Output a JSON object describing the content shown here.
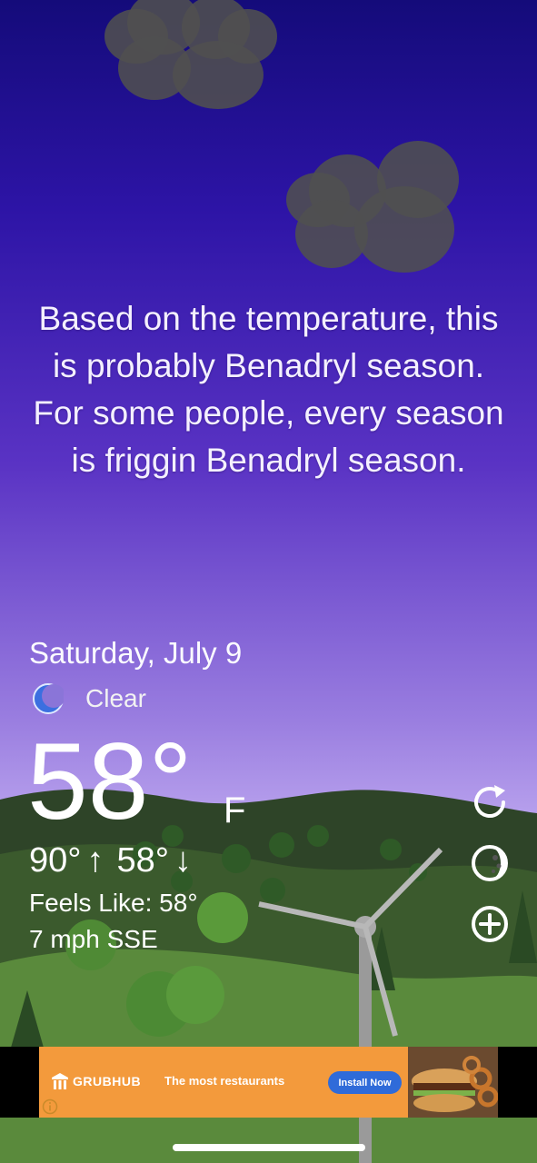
{
  "message": "Based on the temperature, this is probably Benadryl season. For some people, every season is friggin Benadryl season.",
  "weather": {
    "date": "Saturday, July 9",
    "condition": "Clear",
    "condition_icon": "moon-icon",
    "temperature": "58°",
    "unit": "F",
    "high": "90°",
    "high_arrow": "↑",
    "low": "58°",
    "low_arrow": "↓",
    "feels_like": "Feels Like: 58°",
    "wind": "7 mph SSE"
  },
  "side_controls": [
    {
      "name": "refresh-icon"
    },
    {
      "name": "theme-icon"
    },
    {
      "name": "add-location-icon"
    }
  ],
  "ad": {
    "brand": "GRUBHUB",
    "tagline": "The most restaurants",
    "cta": "Install Now",
    "brand_color": "#f39a3c",
    "cta_color": "#2f6bd9"
  },
  "colors": {
    "sky_top": "#140b7a",
    "sky_bottom": "#d8c8f8",
    "hills": "#3a5a2a"
  }
}
